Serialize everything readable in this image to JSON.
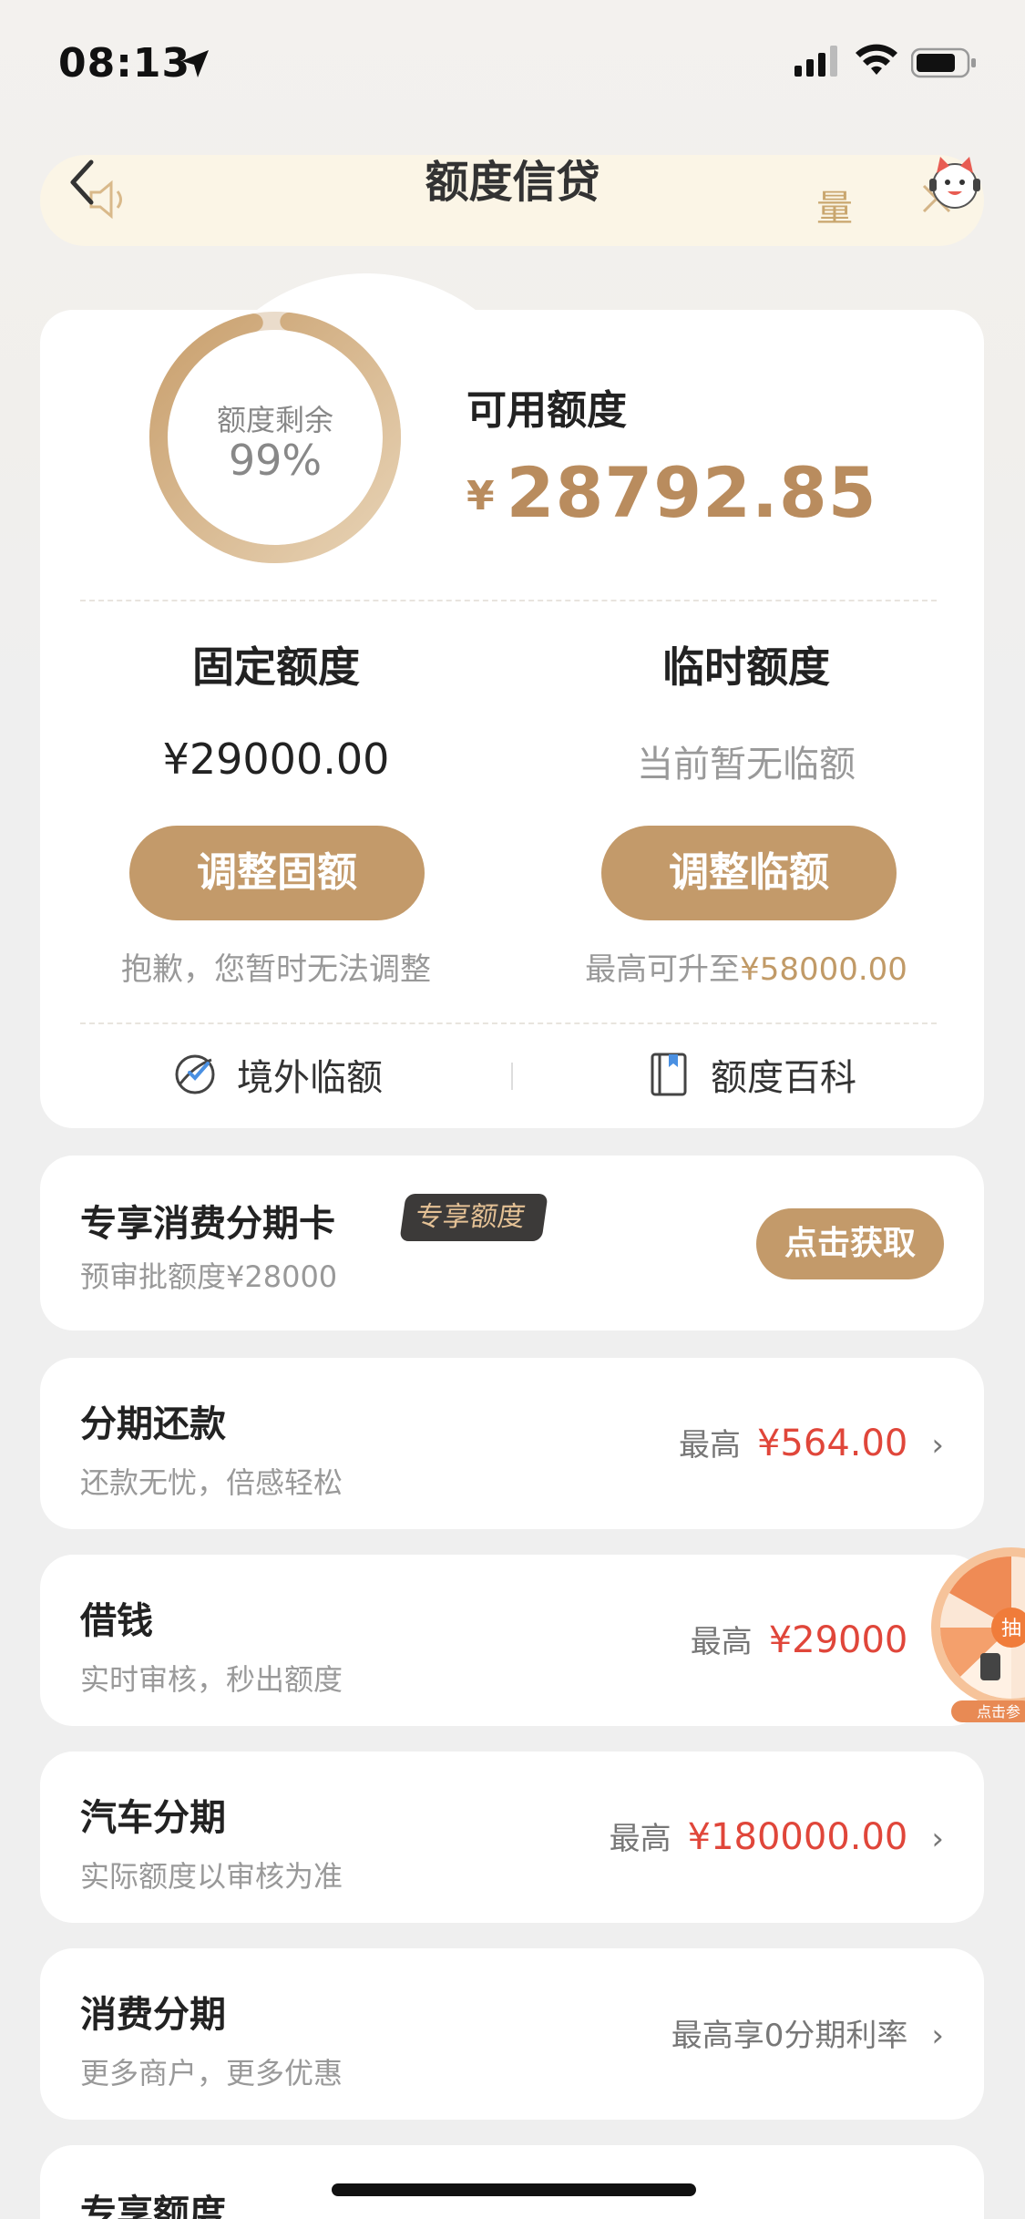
{
  "status": {
    "time": "08:13"
  },
  "nav": {
    "title": "额度信贷",
    "notice_text": "量"
  },
  "quota": {
    "ring_label": "额度剩余",
    "ring_percent": "99%",
    "ring_fraction": 0.99,
    "available_label": "可用额度",
    "available_currency": "¥",
    "available_amount": "28792.85",
    "fixed": {
      "title": "固定额度",
      "value": "¥29000.00",
      "button": "调整固额",
      "note": "抱歉，您暂时无法调整"
    },
    "temp": {
      "title": "临时额度",
      "value": "当前暂无临额",
      "button": "调整临额",
      "note_prefix": "最高可升至",
      "note_amount": "¥58000.00"
    },
    "links": {
      "overseas": "境外临额",
      "wiki": "额度百科"
    }
  },
  "exclusive_card": {
    "title": "专享消费分期卡",
    "badge": "专享额度",
    "subtitle": "预审批额度¥28000",
    "button": "点击获取"
  },
  "rows": [
    {
      "title": "分期还款",
      "subtitle": "还款无忧，倍感轻松",
      "label": "最高",
      "amount": "¥564.00"
    },
    {
      "title": "借钱",
      "subtitle": "实时审核，秒出额度",
      "label": "最高",
      "amount": "¥29000"
    },
    {
      "title": "汽车分期",
      "subtitle": "实际额度以审核为准",
      "label": "最高",
      "amount": "¥180000.00"
    },
    {
      "title": "消费分期",
      "subtitle": "更多商户，更多优惠",
      "label": "最高享0分期利率"
    },
    {
      "title": "专享额度"
    }
  ],
  "float_wheel": {
    "center": "抽",
    "caption": "点击参"
  },
  "colors": {
    "gold": "#c39a6a",
    "red": "#e0463a",
    "badge_bg": "#3c3a39"
  }
}
